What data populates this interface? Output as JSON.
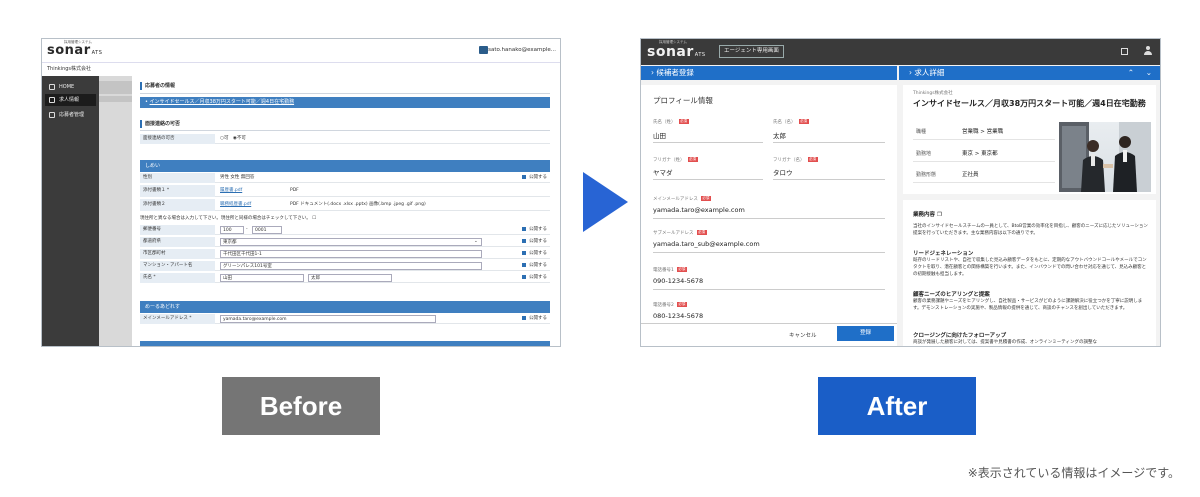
{
  "before": {
    "logo": "sonar",
    "logo_suffix": "ATS",
    "logo_tagline": "採用管理システム",
    "user_email": "sato.hanako@example...",
    "company": "Thinkings株式会社",
    "sidebar": [
      {
        "label": "HOME",
        "active": false
      },
      {
        "label": "求人情報",
        "active": true
      },
      {
        "label": "応募者管理",
        "active": false
      }
    ],
    "section_applicant": "応募者の情報",
    "job_link": "インサイドセールス／月収38万円スタート可能／週4日在宅勤務",
    "section_contact": "面接連絡の可否",
    "contact_label": "面接連絡の可否",
    "contact_options": [
      "可",
      "不可"
    ],
    "group_basic": "しめい",
    "rows": [
      {
        "label": "性別",
        "value": "男性  女性  無回答",
        "public": "公開する"
      },
      {
        "label": "添付書類１ *",
        "value": "履歴書.pdf",
        "extra": "PDF",
        "public": ""
      },
      {
        "label": "添付書類２",
        "value": "職務経歴書.pdf",
        "extra": "PDF  ドキュメント(.docx .xlsx .pptx)  画像(.bmp .jpeg .gif .png)",
        "public": ""
      }
    ],
    "note_address": "現住所と異なる場合は入力して下さい。現住所と同様の場合はチェックして下さい。",
    "address_rows": [
      {
        "label": "郵便番号",
        "value1": "100",
        "value2": "0001",
        "public": "公開する"
      },
      {
        "label": "都道府県",
        "value1": "東京都",
        "public": "公開する"
      },
      {
        "label": "市区郡町村",
        "value1": "千代田区千代田1-1",
        "public": "公開する"
      },
      {
        "label": "マンション・アパート名",
        "value1": "グリーンパレス101号室",
        "public": "公開する"
      },
      {
        "label": "氏名 *",
        "value1": "山田",
        "value2": "太郎",
        "public": "公開する"
      }
    ],
    "group_email": "めーるあどれす",
    "email_label": "メインメールアドレス *",
    "email_value": "yamada.taro@example.com",
    "email_public": "公開する"
  },
  "after": {
    "logo": "sonar",
    "logo_suffix": "ATS",
    "logo_tagline": "採用管理システム",
    "agent_button": "エージェント専用画面",
    "left_panel_title": "候補者登録",
    "right_panel_title": "求人詳細",
    "profile_heading": "プロフィール情報",
    "required_badge": "必須",
    "fields": [
      {
        "label": "氏名（姓）",
        "value": "山田",
        "required": true
      },
      {
        "label": "氏名（名）",
        "value": "太郎",
        "required": true
      },
      {
        "label": "フリガナ（姓）",
        "value": "ヤマダ",
        "required": true
      },
      {
        "label": "フリガナ（名）",
        "value": "タロウ",
        "required": true
      },
      {
        "label": "メインメールアドレス",
        "value": "yamada.taro@example.com",
        "required": true
      },
      {
        "label": "サブメールアドレス",
        "value": "yamada.taro_sub@example.com",
        "required": true
      },
      {
        "label": "電話番号1",
        "value": "090-1234-5678",
        "required": true
      },
      {
        "label": "電話番号2",
        "value": "080-1234-5678",
        "required": true
      }
    ],
    "cancel": "キャンセル",
    "submit": "登録",
    "job_company": "Thinkings株式会社",
    "job_title": "インサイドセールス／月収38万円スタート可能／週4日在宅勤務",
    "job_rows": [
      {
        "label": "職種",
        "value": "営業職 > 営業職"
      },
      {
        "label": "勤務地",
        "value": "東京 > 東京都"
      },
      {
        "label": "勤務形態",
        "value": "正社員"
      }
    ],
    "desc_heading": "業務内容",
    "desc_intro": "当社のインサイドセールスチームの一員として、BtoB営業の効率化を目指し、顧客のニーズに応じたソリューション提案を行っていただきます。主な業務内容は以下の通りです。",
    "desc_sections": [
      {
        "title": "リードジェネレーション",
        "text": "既存のリードリストや、自社で収集した見込み顧客データをもとに、定期的なアウトバウンドコールやメールでコンタクトを取り、潜在顧客との関係構築を行います。また、インバウンドでの問い合わせ対応を通じて、見込み顧客との初期接触も担当します。"
      },
      {
        "title": "顧客ニーズのヒアリングと提案",
        "text": "顧客の業務課題やニーズをヒアリングし、自社製品・サービスがどのように課題解決に役立つかを丁寧に説明します。デモンストレーションの実施や、製品情報の提供を通じて、商談のチャンスを創出していただきます。"
      },
      {
        "title": "クロージングに向けたフォローアップ",
        "text": "商談が発展した顧客に対しては、提案書や見積書の作成、オンラインミーティングの調整な"
      }
    ]
  },
  "labels": {
    "before": "Before",
    "after": "After",
    "note": "※表示されている情報はイメージです。"
  },
  "colors": {
    "accent_blue": "#1f6fc8",
    "arrow_blue": "#2864d4",
    "before_label": "#757575",
    "after_label": "#1a5ec7",
    "required": "#e24e4e"
  }
}
